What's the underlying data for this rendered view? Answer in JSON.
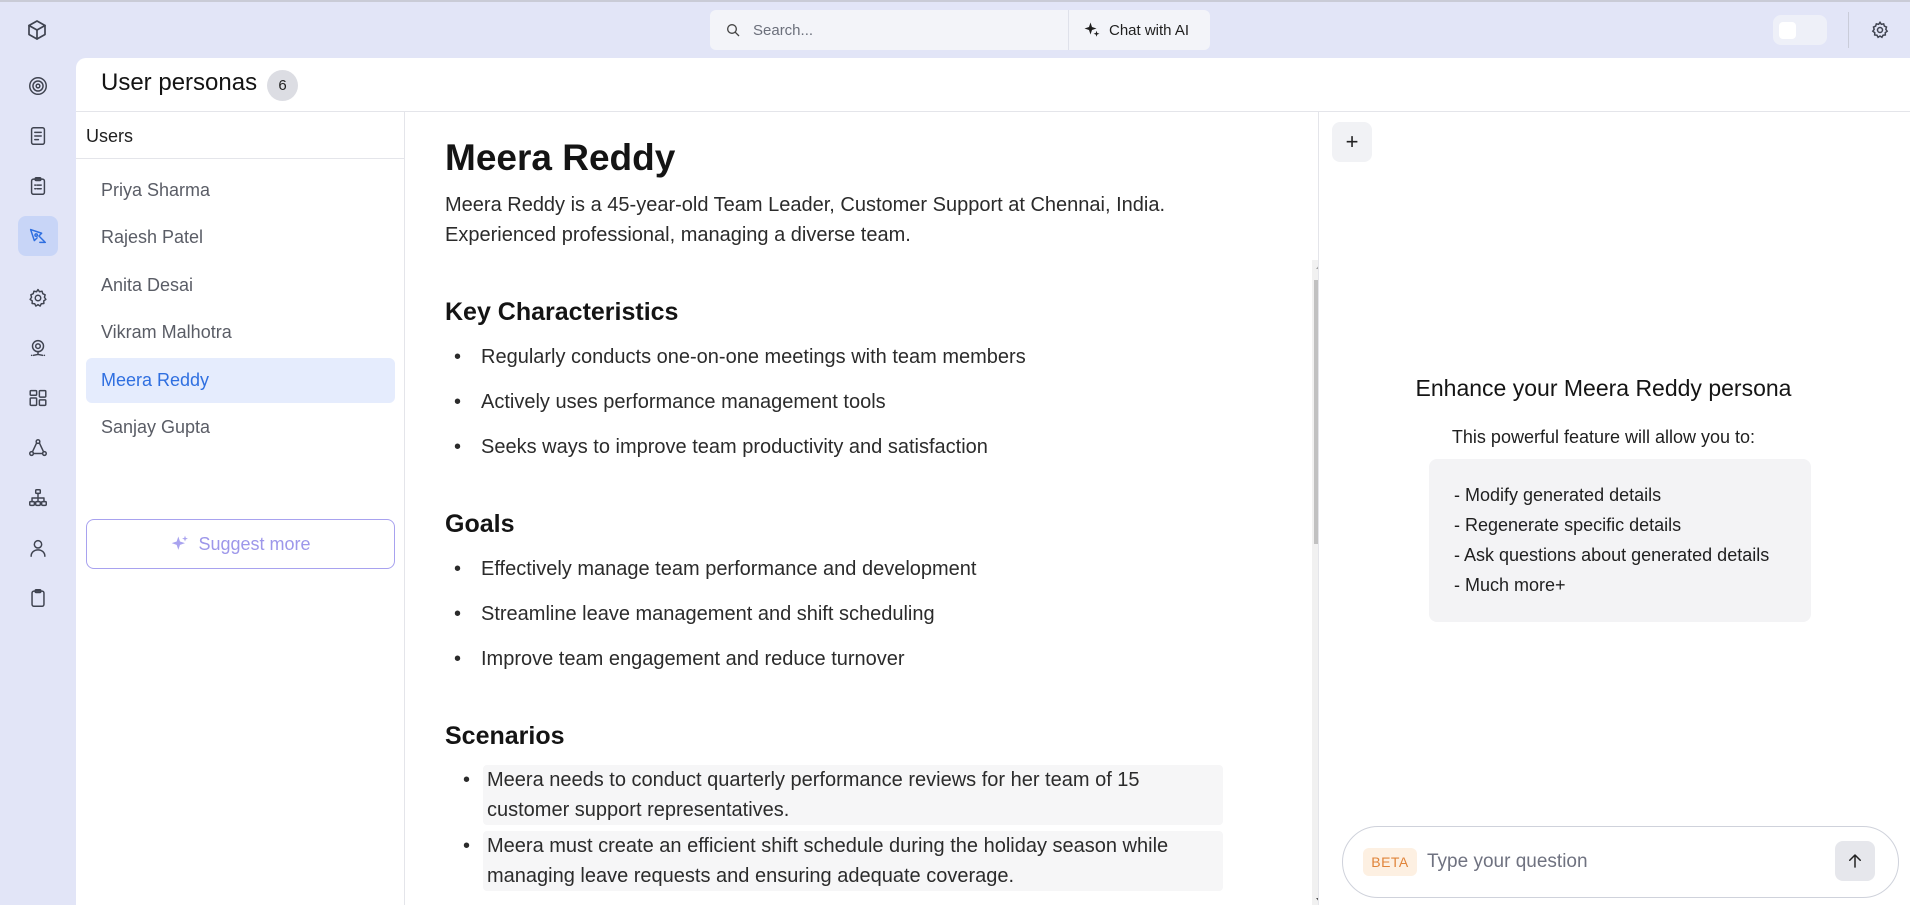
{
  "search": {
    "placeholder": "Search...",
    "chat_label": "Chat with AI"
  },
  "rail": {
    "items": [
      {
        "icon": "target-icon"
      },
      {
        "icon": "document-list-icon"
      },
      {
        "icon": "clipboard-list-icon"
      },
      {
        "icon": "design-pen-icon",
        "active": true
      },
      {
        "icon": "gear-icon"
      },
      {
        "icon": "settings-network-icon"
      },
      {
        "icon": "dashboard-grid-icon"
      },
      {
        "icon": "flow-cycle-icon"
      },
      {
        "icon": "sitemap-icon"
      },
      {
        "icon": "user-icon"
      },
      {
        "icon": "clipboard-icon"
      }
    ]
  },
  "header": {
    "title": "User personas",
    "count": "6"
  },
  "users": {
    "heading": "Users",
    "items": [
      "Priya Sharma",
      "Rajesh Patel",
      "Anita Desai",
      "Vikram Malhotra",
      "Meera Reddy",
      "Sanjay Gupta"
    ],
    "selected": "Meera Reddy",
    "suggest_label": "Suggest more"
  },
  "persona": {
    "name": "Meera Reddy",
    "summary": "Meera Reddy is a 45-year-old Team Leader, Customer Support at Chennai, India. Experienced professional, managing a diverse team.",
    "characteristics_heading": "Key Characteristics",
    "characteristics": [
      "Regularly conducts one-on-one meetings with team members",
      "Actively uses performance management tools",
      "Seeks ways to improve team productivity and satisfaction"
    ],
    "goals_heading": "Goals",
    "goals": [
      "Effectively manage team performance and development",
      "Streamline leave management and shift scheduling",
      "Improve team engagement and reduce turnover"
    ],
    "scenarios_heading": "Scenarios",
    "scenarios": [
      "Meera needs to conduct quarterly performance reviews for her team of 15 customer support representatives.",
      "Meera must create an efficient shift schedule during the holiday season while managing leave requests and ensuring adequate coverage."
    ]
  },
  "enhance": {
    "add_label": "+",
    "title": "Enhance your Meera Reddy persona",
    "subtitle": "This powerful feature will allow you to:",
    "features": [
      "- Modify generated details",
      "- Regenerate specific details",
      "- Ask questions about generated details",
      "- Much more+"
    ]
  },
  "ask": {
    "badge": "BETA",
    "placeholder": "Type your question"
  },
  "colors": {
    "accent": "#2f6fe0",
    "selected_bg": "#e5ecfd",
    "suggest": "#9d97ea",
    "beta": "#e0843a",
    "app_bg": "#e2e5f7"
  }
}
